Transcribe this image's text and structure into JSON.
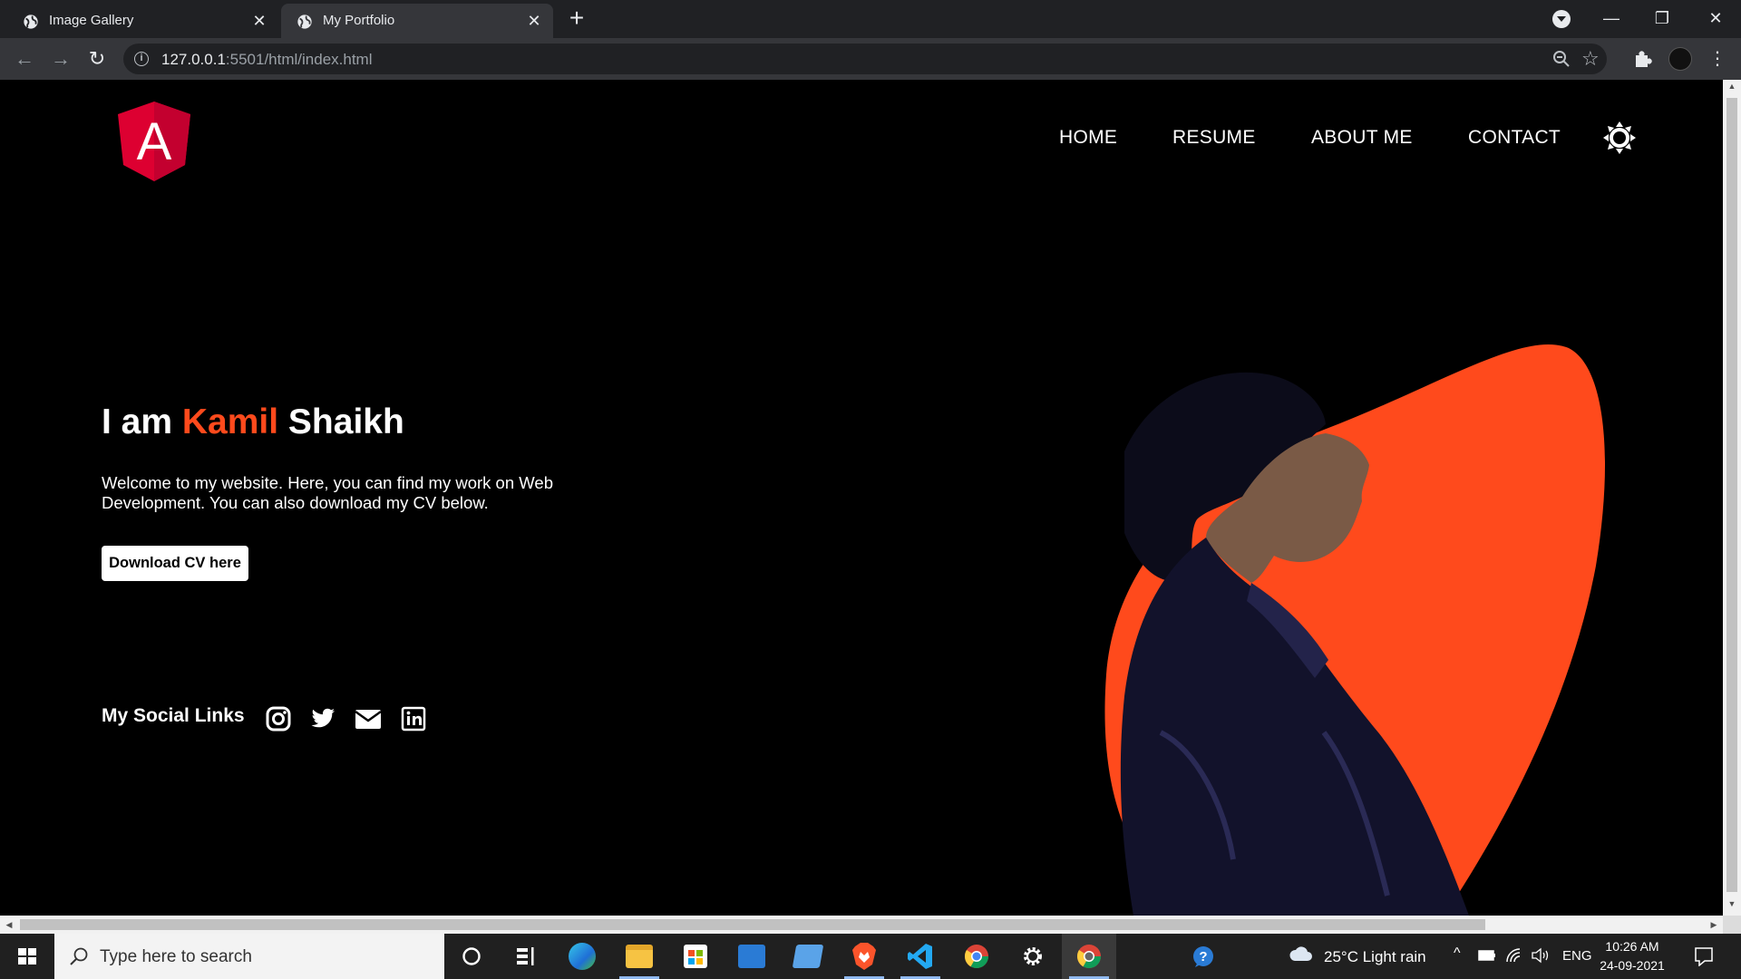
{
  "browser": {
    "tabs": [
      {
        "title": "Image Gallery",
        "active": false
      },
      {
        "title": "My Portfolio",
        "active": true
      }
    ],
    "url_host": "127.0.0.1",
    "url_rest": ":5501/html/index.html"
  },
  "site": {
    "logo_letter": "A",
    "nav": [
      "HOME",
      "RESUME",
      "ABOUT ME",
      "CONTACT"
    ],
    "hero": {
      "title_prefix": "I am ",
      "title_accent": "Kamil",
      "title_suffix": " Shaikh",
      "description": "Welcome to my website. Here, you can find my work on Web Development. You can also download my CV below.",
      "cv_button": "Download CV here"
    },
    "social_label": "My Social Links",
    "social_icons": [
      "instagram-icon",
      "twitter-icon",
      "mail-icon",
      "linkedin-icon"
    ]
  },
  "taskbar": {
    "search_placeholder": "Type here to search",
    "weather": "25°C  Light rain",
    "language": "ENG",
    "time": "10:26 AM",
    "date": "24-09-2021"
  },
  "colors": {
    "accent": "#ff4a1c",
    "angular_red": "#dd0031",
    "page_bg": "#000000"
  }
}
